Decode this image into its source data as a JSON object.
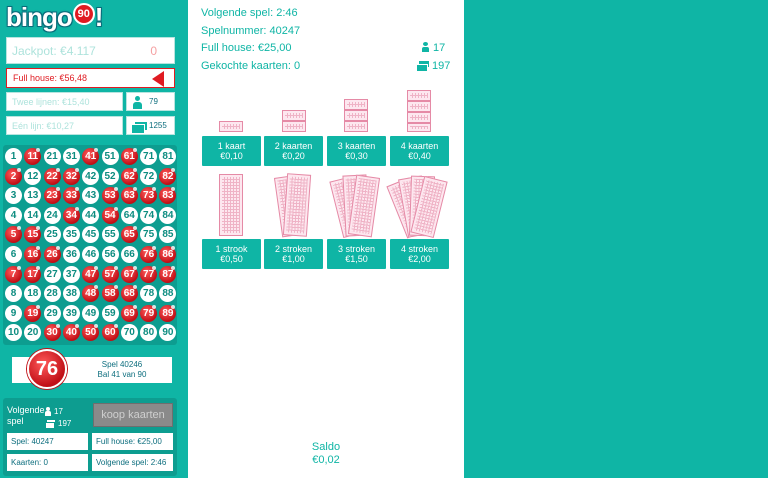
{
  "brand": {
    "word": "bingo",
    "badge": "90",
    "exclaim": "!"
  },
  "jackpot": {
    "label": "Jackpot: €4.117",
    "value": "0"
  },
  "prizes": {
    "full_house": "Full house: €56,48",
    "two_lines": "Twee lijnen: €15,40",
    "one_line": "Eén lijn: €10,27",
    "players": "79",
    "cards": "1255"
  },
  "board": {
    "rows": [
      [
        "1",
        "11",
        "21",
        "31",
        "41",
        "51",
        "61",
        "71",
        "81"
      ],
      [
        "2",
        "12",
        "22",
        "32",
        "42",
        "52",
        "62",
        "72",
        "82"
      ],
      [
        "3",
        "13",
        "23",
        "33",
        "43",
        "53",
        "63",
        "73",
        "83"
      ],
      [
        "4",
        "14",
        "24",
        "34",
        "44",
        "54",
        "64",
        "74",
        "84"
      ],
      [
        "5",
        "15",
        "25",
        "35",
        "45",
        "55",
        "65",
        "75",
        "85"
      ],
      [
        "6",
        "16",
        "26",
        "36",
        "46",
        "56",
        "66",
        "76",
        "86"
      ],
      [
        "7",
        "17",
        "27",
        "37",
        "47",
        "57",
        "67",
        "77",
        "87"
      ],
      [
        "8",
        "18",
        "28",
        "38",
        "48",
        "58",
        "68",
        "78",
        "88"
      ],
      [
        "9",
        "19",
        "29",
        "39",
        "49",
        "59",
        "69",
        "79",
        "89"
      ],
      [
        "10",
        "20",
        "30",
        "40",
        "50",
        "60",
        "70",
        "80",
        "90"
      ]
    ],
    "drawn": [
      "11",
      "41",
      "61",
      "2",
      "22",
      "32",
      "62",
      "23",
      "33",
      "63",
      "73",
      "83",
      "34",
      "54",
      "5",
      "65",
      "16",
      "86",
      "7",
      "17",
      "47",
      "57",
      "67",
      "77",
      "87",
      "48",
      "58",
      "68",
      "19",
      "69",
      "79",
      "89",
      "30",
      "40",
      "50",
      "60",
      "76",
      "26",
      "53",
      "15",
      "82"
    ]
  },
  "current": {
    "ball": "76",
    "game_line": "Spel 40246",
    "ball_line": "Bal 41 van 90"
  },
  "next_panel": {
    "title": "Volgende spel",
    "players": "17",
    "cards": "197",
    "buy_label": "koop kaarten",
    "game": "Spel: 40247",
    "full_house": "Full house: €25,00",
    "cards_bought": "Kaarten: 0",
    "next_time": "Volgende spel: 2:46"
  },
  "center": {
    "next_game": "Volgende spel: 2:46",
    "game_number": "Spelnummer: 40247",
    "full_house": "Full house: €25,00",
    "bought": "Gekochte kaarten: 0",
    "players": "17",
    "cards": "197"
  },
  "options": [
    {
      "name": "1 kaart",
      "price": "€0,10"
    },
    {
      "name": "2 kaarten",
      "price": "€0,20"
    },
    {
      "name": "3 kaarten",
      "price": "€0,30"
    },
    {
      "name": "4 kaarten",
      "price": "€0,40"
    },
    {
      "name": "1 strook",
      "price": "€0,50"
    },
    {
      "name": "2 stroken",
      "price": "€1,00"
    },
    {
      "name": "3 stroken",
      "price": "€1,50"
    },
    {
      "name": "4 stroken",
      "price": "€2,00"
    }
  ],
  "saldo": {
    "label": "Saldo",
    "value": "€0,02"
  },
  "colors": {
    "teal": "#0fb5a5",
    "red": "#e01b22",
    "white": "#ffffff"
  }
}
